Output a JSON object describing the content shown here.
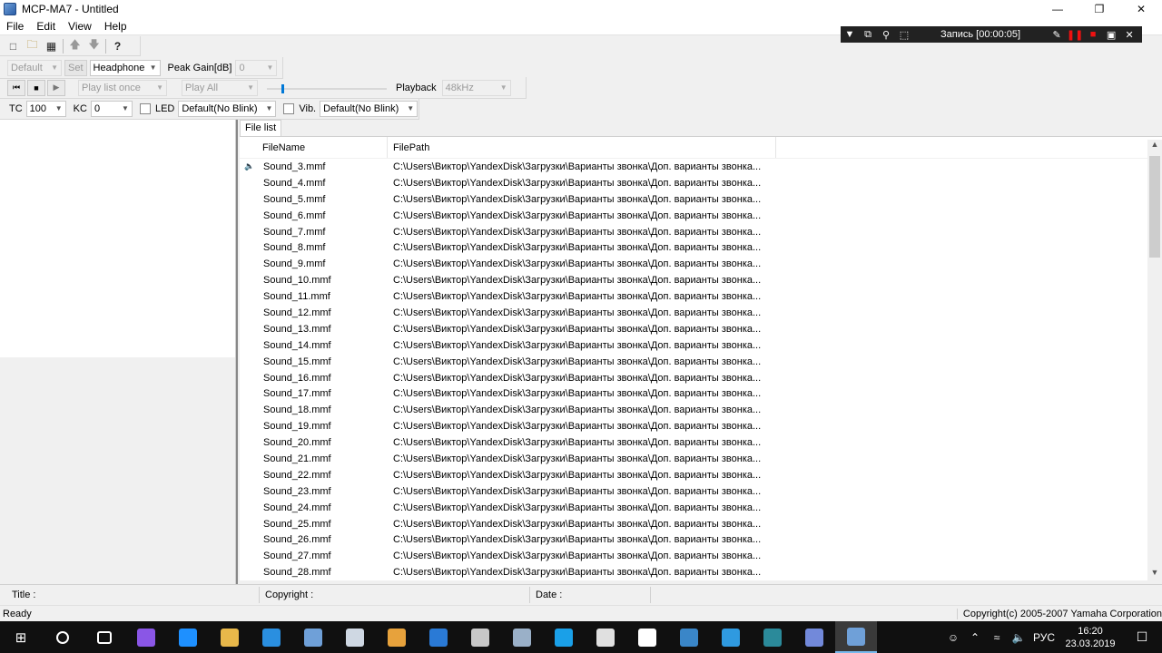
{
  "window": {
    "title": "MCP-MA7 - Untitled",
    "minimize_icon": "minimize-icon",
    "restore_icon": "restore-icon",
    "close_icon": "close-icon"
  },
  "menu": [
    "File",
    "Edit",
    "View",
    "Help"
  ],
  "toolbar1": {
    "icons": [
      "new-file-icon",
      "open-folder-icon",
      "save-icon",
      "move-up-icon",
      "move-down-icon",
      "help-icon"
    ]
  },
  "toolbar2": {
    "preset_value": "Default",
    "set_label": "Set",
    "output_value": "Headphone",
    "peak_gain_label": "Peak Gain[dB]",
    "peak_gain_value": "0"
  },
  "toolbar3": {
    "play_mode_value": "Play list once",
    "play_all_value": "Play All",
    "playback_label": "Playback",
    "playback_rate_value": "48kHz",
    "volume_level": 0.12
  },
  "toolbar4": {
    "tc_label": "TC",
    "tc_value": "100",
    "kc_label": "KC",
    "kc_value": "0",
    "led_label": "LED",
    "led_value": "Default(No Blink)",
    "vib_label": "Vib.",
    "vib_value": "Default(No Blink)"
  },
  "recorder": {
    "label": "Запись [00:00:05]"
  },
  "filelist": {
    "tab_label": "File list",
    "columns": [
      "FileName",
      "FilePath"
    ],
    "path_value": "C:\\Users\\Виктор\\YandexDisk\\Загрузки\\Варианты звонка\\Доп. варианты звонка...",
    "rows": [
      "Sound_3.mmf",
      "Sound_4.mmf",
      "Sound_5.mmf",
      "Sound_6.mmf",
      "Sound_7.mmf",
      "Sound_8.mmf",
      "Sound_9.mmf",
      "Sound_10.mmf",
      "Sound_11.mmf",
      "Sound_12.mmf",
      "Sound_13.mmf",
      "Sound_14.mmf",
      "Sound_15.mmf",
      "Sound_16.mmf",
      "Sound_17.mmf",
      "Sound_18.mmf",
      "Sound_19.mmf",
      "Sound_20.mmf",
      "Sound_21.mmf",
      "Sound_22.mmf",
      "Sound_23.mmf",
      "Sound_24.mmf",
      "Sound_25.mmf",
      "Sound_26.mmf",
      "Sound_27.mmf",
      "Sound_28.mmf"
    ]
  },
  "infobar": {
    "title_label": "Title :",
    "copyright_label": "Copyright :",
    "date_label": "Date :"
  },
  "statusbar": {
    "status": "Ready",
    "copyright": "Copyright(c) 2005-2007 Yamaha Corporation"
  },
  "taskbar": {
    "apps": [
      {
        "name": "search",
        "color": "#101010"
      },
      {
        "name": "task-view",
        "color": "#101010"
      },
      {
        "name": "alice",
        "color": "#8a56e6"
      },
      {
        "name": "edge",
        "color": "#1e90ff"
      },
      {
        "name": "explorer",
        "color": "#e8b84a"
      },
      {
        "name": "internet-explorer",
        "color": "#2a8fe0"
      },
      {
        "name": "image-viewer",
        "color": "#6fa0d8"
      },
      {
        "name": "app-3d",
        "color": "#cfd8e3"
      },
      {
        "name": "media-player",
        "color": "#e7a23c"
      },
      {
        "name": "shield",
        "color": "#2a7ad6"
      },
      {
        "name": "calculator",
        "color": "#c8c8c8"
      },
      {
        "name": "paint",
        "color": "#9ab0c8"
      },
      {
        "name": "skype",
        "color": "#1aa0e8"
      },
      {
        "name": "store",
        "color": "#e0e0e0"
      },
      {
        "name": "yandex-browser",
        "color": "#ffffff"
      },
      {
        "name": "game",
        "color": "#3a86c8"
      },
      {
        "name": "tiles",
        "color": "#2f9ae0"
      },
      {
        "name": "movie-app",
        "color": "#2b8a9a"
      },
      {
        "name": "discord",
        "color": "#7289da"
      },
      {
        "name": "mcp-ma7",
        "color": "#6fa0d8"
      }
    ],
    "language": "РУС",
    "time": "16:20",
    "date": "23.03.2019"
  }
}
